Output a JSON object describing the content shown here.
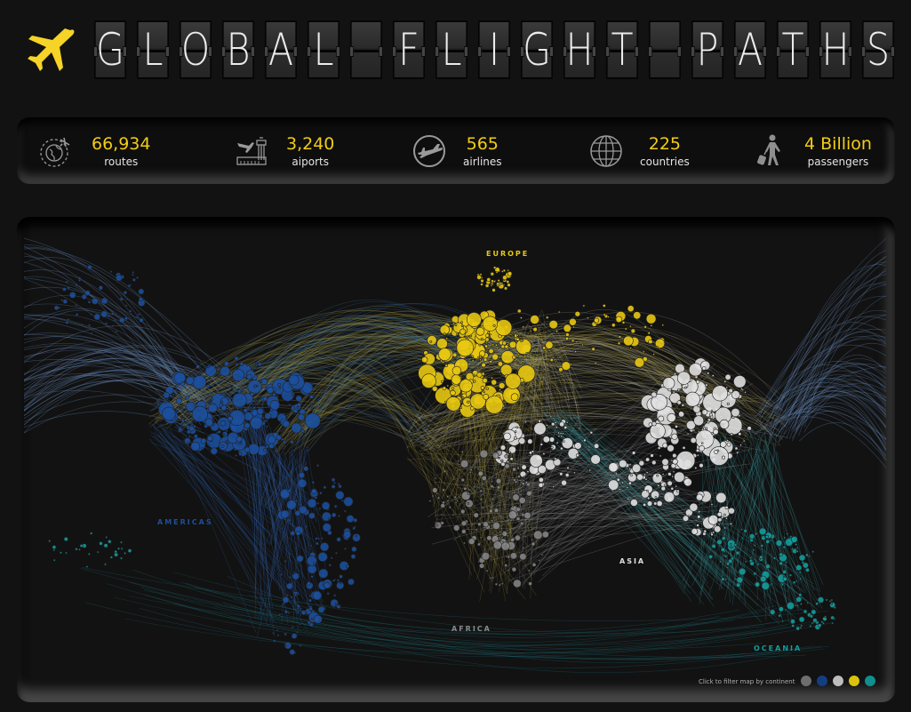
{
  "header": {
    "logo_icon": "airplane-icon",
    "title": "GLOBAL FLIGHT PATHS",
    "accent_color": "#f5d327"
  },
  "kpis": [
    {
      "id": "routes",
      "icon": "globe-route-icon",
      "value": "66,934",
      "label": "routes"
    },
    {
      "id": "airports",
      "icon": "airport-tower-icon",
      "value": "3,240",
      "label": "aiports"
    },
    {
      "id": "airlines",
      "icon": "plane-circle-icon",
      "value": "565",
      "label": "airlines"
    },
    {
      "id": "countries",
      "icon": "globe-icon",
      "value": "225",
      "label": "countries"
    },
    {
      "id": "passengers",
      "icon": "traveler-icon",
      "value": "4 Billion",
      "label": "passengers"
    }
  ],
  "map": {
    "regions": [
      {
        "id": "europe",
        "label": "EUROPE",
        "color": "#e8c812"
      },
      {
        "id": "americas",
        "label": "AMERICAS",
        "color": "#1c4f9c"
      },
      {
        "id": "africa",
        "label": "AFRICA",
        "color": "#8a8a8a"
      },
      {
        "id": "asia",
        "label": "ASIA",
        "color": "#e0e0e0"
      },
      {
        "id": "oceania",
        "label": "OCEANIA",
        "color": "#139c9c"
      }
    ],
    "legend": {
      "text": "Click to filter map by continent",
      "items": [
        {
          "id": "africa",
          "color": "#6e6e6e"
        },
        {
          "id": "americas",
          "color": "#123f82"
        },
        {
          "id": "asia",
          "color": "#bdbdbd"
        },
        {
          "id": "europe",
          "color": "#dcc30a"
        },
        {
          "id": "oceania",
          "color": "#0f8f8f"
        }
      ]
    }
  }
}
